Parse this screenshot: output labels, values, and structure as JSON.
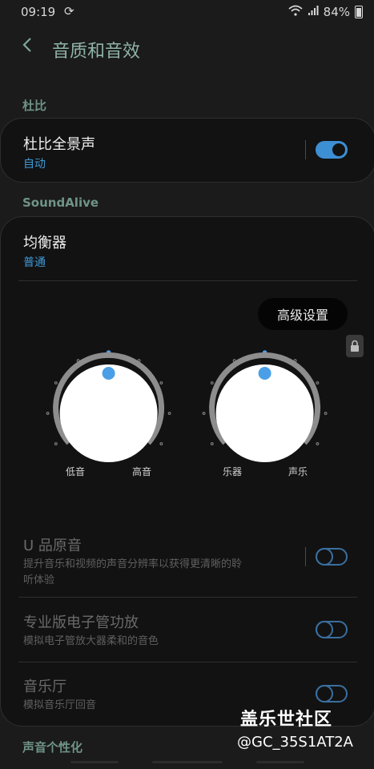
{
  "status": {
    "time": "09:19",
    "battery": "84%"
  },
  "header": {
    "title": "音质和音效"
  },
  "sections": {
    "dolby": "杜比",
    "soundalive": "SoundAlive",
    "personal": "声音个性化"
  },
  "dolby_atmos": {
    "title": "杜比全景声",
    "subtitle": "自动",
    "enabled": true
  },
  "equalizer": {
    "title": "均衡器",
    "subtitle": "普通"
  },
  "advanced_button": "高级设置",
  "knobs": [
    {
      "left_label": "低音",
      "right_label": "高音"
    },
    {
      "left_label": "乐器",
      "right_label": "声乐"
    }
  ],
  "settings": [
    {
      "title": "U 品原音",
      "desc1": "提升音乐和视频的声音分辨率以获得更清晰的聆",
      "desc2": "听体验",
      "enabled": false
    },
    {
      "title": "专业版电子管功放",
      "desc1": "模拟电子管放大器柔和的音色",
      "enabled": false
    },
    {
      "title": "音乐厅",
      "desc1": "模拟音乐厅回音",
      "enabled": false
    }
  ],
  "watermark": {
    "brand": "盖乐世社区",
    "handle": "@GC_35S1AT2A"
  },
  "colors": {
    "accent": "#3d8fd4",
    "section": "#6f9487"
  }
}
